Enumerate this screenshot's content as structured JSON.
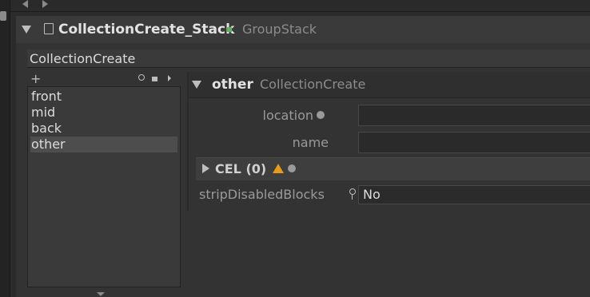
{
  "header": {
    "title": "CollectionCreate_Stack",
    "type": "GroupStack"
  },
  "node": {
    "label": "CollectionCreate"
  },
  "list": {
    "items": [
      "front",
      "mid",
      "back",
      "other"
    ],
    "selected": "other"
  },
  "section": {
    "name": "other",
    "type": "CollectionCreate"
  },
  "params": {
    "location_label": "location",
    "location_value": "",
    "name_label": "name",
    "name_value": "",
    "cel_label": "CEL (0)",
    "strip_label": "stripDisabledBlocks",
    "strip_value": "No"
  },
  "icons": {
    "add": "plus-icon",
    "search": "search-icon",
    "lock": "lock-icon",
    "scroll_right": "chevron-right-icon",
    "warning": "warning-icon",
    "info": "info-icon",
    "key": "key-icon"
  },
  "colors": {
    "accent_green": "#5fb25f",
    "warning": "#e79a1d"
  }
}
